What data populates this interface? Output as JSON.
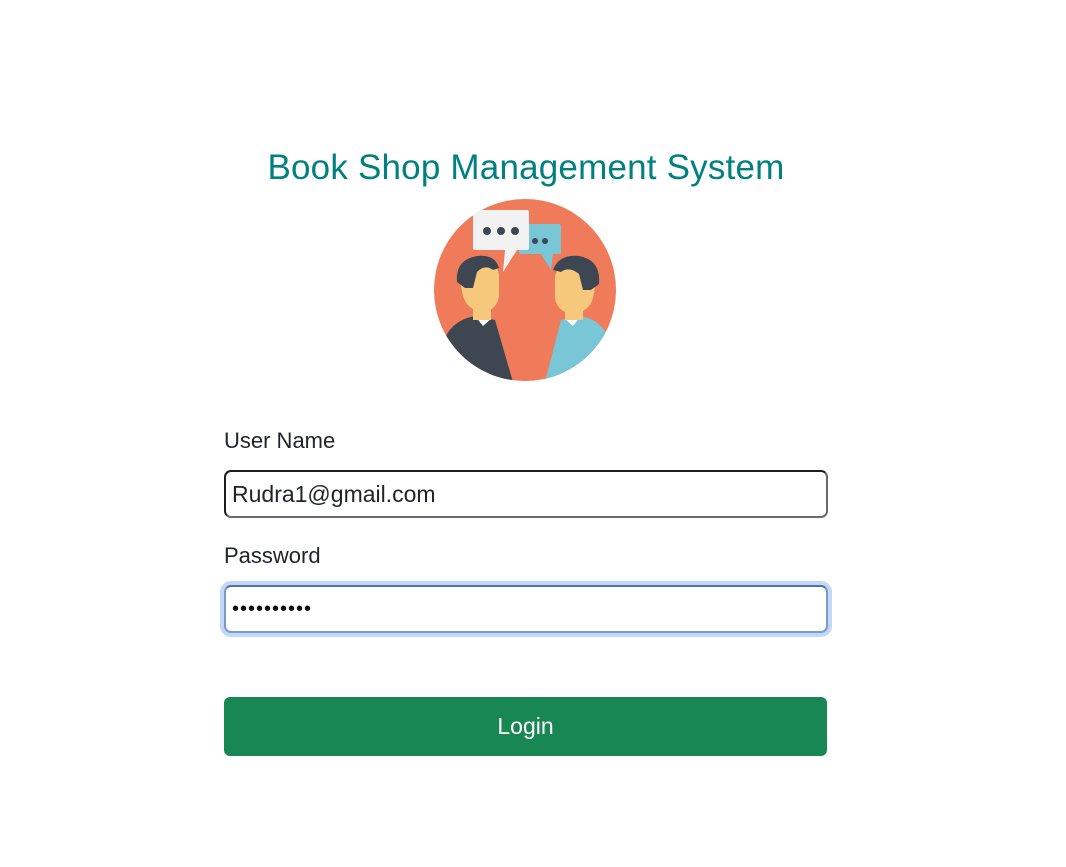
{
  "header": {
    "title": "Book Shop Management System"
  },
  "logo": {
    "icon": "conversation-illustration-icon"
  },
  "form": {
    "username_label": "User Name",
    "username_value": "Rudra1@gmail.com",
    "password_label": "Password",
    "password_value": "••••••••••",
    "login_label": "Login"
  },
  "colors": {
    "title": "#008080",
    "button": "#198754",
    "logo_circle": "#f07b5a",
    "focus_ring": "#c3d7f8"
  }
}
